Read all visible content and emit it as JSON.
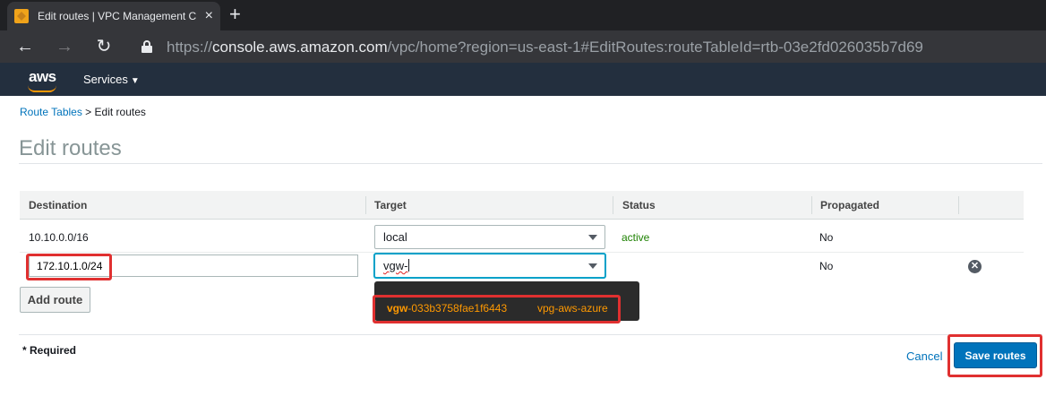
{
  "browser": {
    "tab_title": "Edit routes | VPC Management C",
    "tab_close": "×",
    "new_tab": "+",
    "url_prefix": "https://",
    "url_host": "console.aws.amazon.com",
    "url_path": "/vpc/home?region=us-east-1#EditRoutes:routeTableId=rtb-03e2fd026035b7d69",
    "back": "←",
    "forward": "→",
    "reload": "↻"
  },
  "aws_header": {
    "logo_text": "aws",
    "services_label": "Services",
    "services_caret": "▼"
  },
  "breadcrumb": {
    "parent": "Route Tables",
    "separator": " > ",
    "current": "Edit routes"
  },
  "page": {
    "title": "Edit routes"
  },
  "table": {
    "columns": [
      "Destination",
      "Target",
      "Status",
      "Propagated"
    ],
    "rows": [
      {
        "destination": "10.10.0.0/16",
        "target": "local",
        "status": "active",
        "propagated": "No"
      },
      {
        "destination": "172.10.1.0/24",
        "target": "vgw-",
        "status": "",
        "propagated": "No"
      }
    ]
  },
  "dropdown": {
    "option_prefix": "vgw",
    "option_rest": "-033b3758fae1f6443",
    "option_tag": "vpg-aws-azure"
  },
  "buttons": {
    "add_route": "Add route",
    "cancel": "Cancel",
    "save": "Save routes",
    "remove": "✕"
  },
  "footer": {
    "required_note": "* Required"
  },
  "colors": {
    "aws_header": "#232f3e",
    "accent_orange": "#ff9900",
    "primary_button": "#0073bb",
    "highlight": "#e03030",
    "status_active": "#1d8102"
  }
}
